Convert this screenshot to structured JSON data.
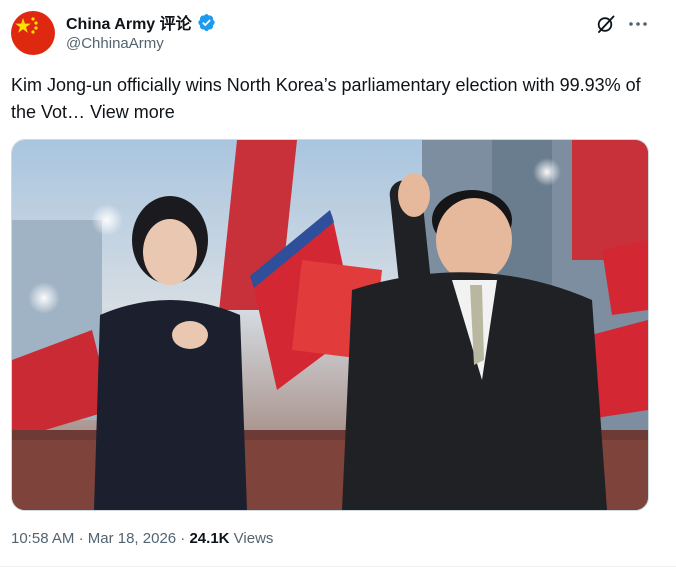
{
  "author": {
    "display_name": "China Army 评论",
    "handle": "@ChhinaArmy",
    "verified": true,
    "avatar_icon": "china-flag-icon"
  },
  "post": {
    "text": "Kim Jong-un officially wins North Korea’s parliamentary election with 99.93% of the Vot…",
    "view_more_label": "View more"
  },
  "header_actions": {
    "grok_icon": "grok-icon",
    "more_icon": "more-dots-icon"
  },
  "meta": {
    "time": "10:58 AM",
    "separator": "·",
    "date": "Mar 18, 2026",
    "views_count": "24.1K",
    "views_label": "Views"
  },
  "colors": {
    "verified_blue": "#1d9bf0",
    "secondary_text": "#536471",
    "primary_text": "#0f1419",
    "flag_red": "#de2910",
    "flag_yellow": "#ffde00"
  }
}
